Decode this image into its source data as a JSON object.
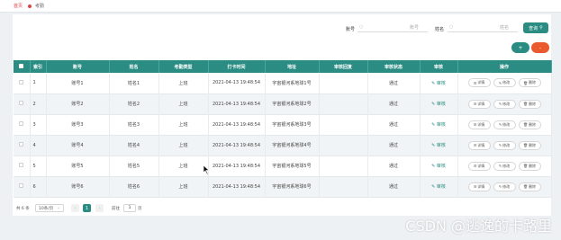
{
  "breadcrumb": {
    "home": "首页",
    "current": "考勤"
  },
  "search": {
    "account_label": "账号",
    "account_placeholder": "账号",
    "name_label": "姓名",
    "name_placeholder": "姓名",
    "button_label": "查询"
  },
  "actions": {
    "add_icon": "+",
    "delete_icon": "-"
  },
  "table": {
    "headers": [
      "索引",
      "账号",
      "姓名",
      "考勤类型",
      "打卡时间",
      "地址",
      "审核回复",
      "审核状态",
      "审核",
      "操作"
    ],
    "rows": [
      {
        "index": "1",
        "account": "账号1",
        "name": "姓名1",
        "type": "上班",
        "time": "2021-04-13 19:48:54",
        "address": "宇宙银河系地球1号",
        "reply": "",
        "status": "通过",
        "audit": "审核"
      },
      {
        "index": "2",
        "account": "账号2",
        "name": "姓名2",
        "type": "上班",
        "time": "2021-04-13 19:48:54",
        "address": "宇宙银河系地球2号",
        "reply": "",
        "status": "通过",
        "audit": "审核"
      },
      {
        "index": "3",
        "account": "账号3",
        "name": "姓名3",
        "type": "上班",
        "time": "2021-04-13 19:48:54",
        "address": "宇宙银河系地球3号",
        "reply": "",
        "status": "通过",
        "audit": "审核"
      },
      {
        "index": "4",
        "account": "账号4",
        "name": "姓名4",
        "type": "上班",
        "time": "2021-04-13 19:48:54",
        "address": "宇宙银河系地球4号",
        "reply": "",
        "status": "通过",
        "audit": "审核"
      },
      {
        "index": "5",
        "account": "账号5",
        "name": "姓名5",
        "type": "上班",
        "time": "2021-04-13 19:48:54",
        "address": "宇宙银河系地球5号",
        "reply": "",
        "status": "通过",
        "audit": "审核"
      },
      {
        "index": "6",
        "account": "账号6",
        "name": "姓名6",
        "type": "上班",
        "time": "2021-04-13 19:48:54",
        "address": "宇宙银河系地球6号",
        "reply": "",
        "status": "通过",
        "audit": "审核"
      }
    ],
    "op_labels": {
      "detail": "详情",
      "edit": "修改",
      "delete": "删除"
    }
  },
  "pagination": {
    "total": "共 6 条",
    "page_size": "10条/页",
    "current_page": "1",
    "goto_label": "前往",
    "goto_value": "1",
    "goto_unit": "页"
  },
  "watermark": "CSDN @逃逸的卡路里",
  "colors": {
    "primary": "#2a8c82",
    "danger": "#ea5a2e",
    "crumb": "#e04545"
  }
}
